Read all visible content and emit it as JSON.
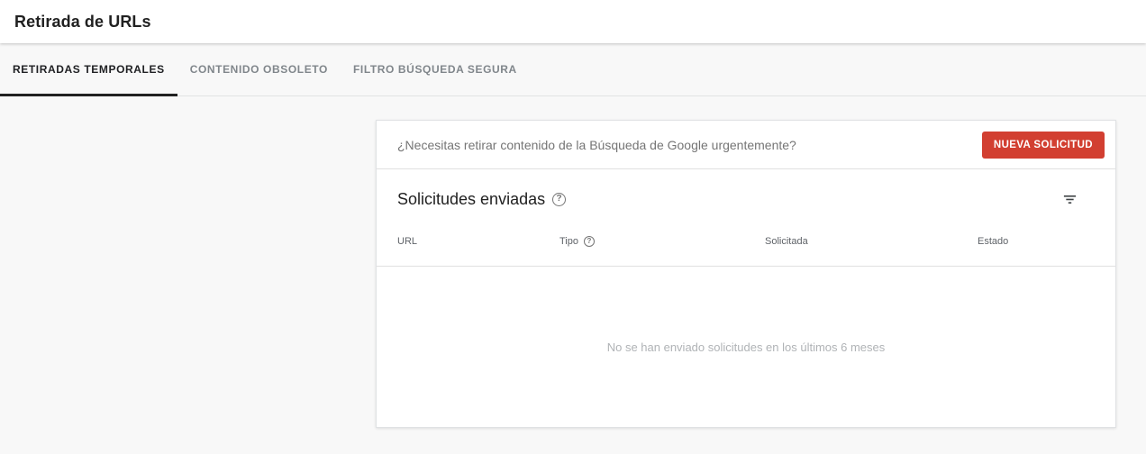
{
  "header": {
    "title": "Retirada de URLs"
  },
  "tabs": [
    {
      "label": "RETIRADAS TEMPORALES",
      "active": true
    },
    {
      "label": "CONTENIDO OBSOLETO",
      "active": false
    },
    {
      "label": "FILTRO BÚSQUEDA SEGURA",
      "active": false
    }
  ],
  "card": {
    "urgent_question": "¿Necesitas retirar contenido de la Búsqueda de Google urgentemente?",
    "new_request_button": "NUEVA SOLICITUD",
    "section_title": "Solicitudes enviadas",
    "table": {
      "columns": [
        "URL",
        "Tipo",
        "Solicitada",
        "Estado"
      ],
      "rows": [],
      "empty_message": "No se han enviado solicitudes en los últimos 6 meses"
    }
  },
  "icons": {
    "help_glyph": "?",
    "help": "help-circle-icon",
    "filter": "filter-list-icon"
  },
  "colors": {
    "accent_red": "#d23f31",
    "active_tab_text": "#202124",
    "inactive_tab_text": "#80868b",
    "active_tab_underline": "#212121"
  }
}
